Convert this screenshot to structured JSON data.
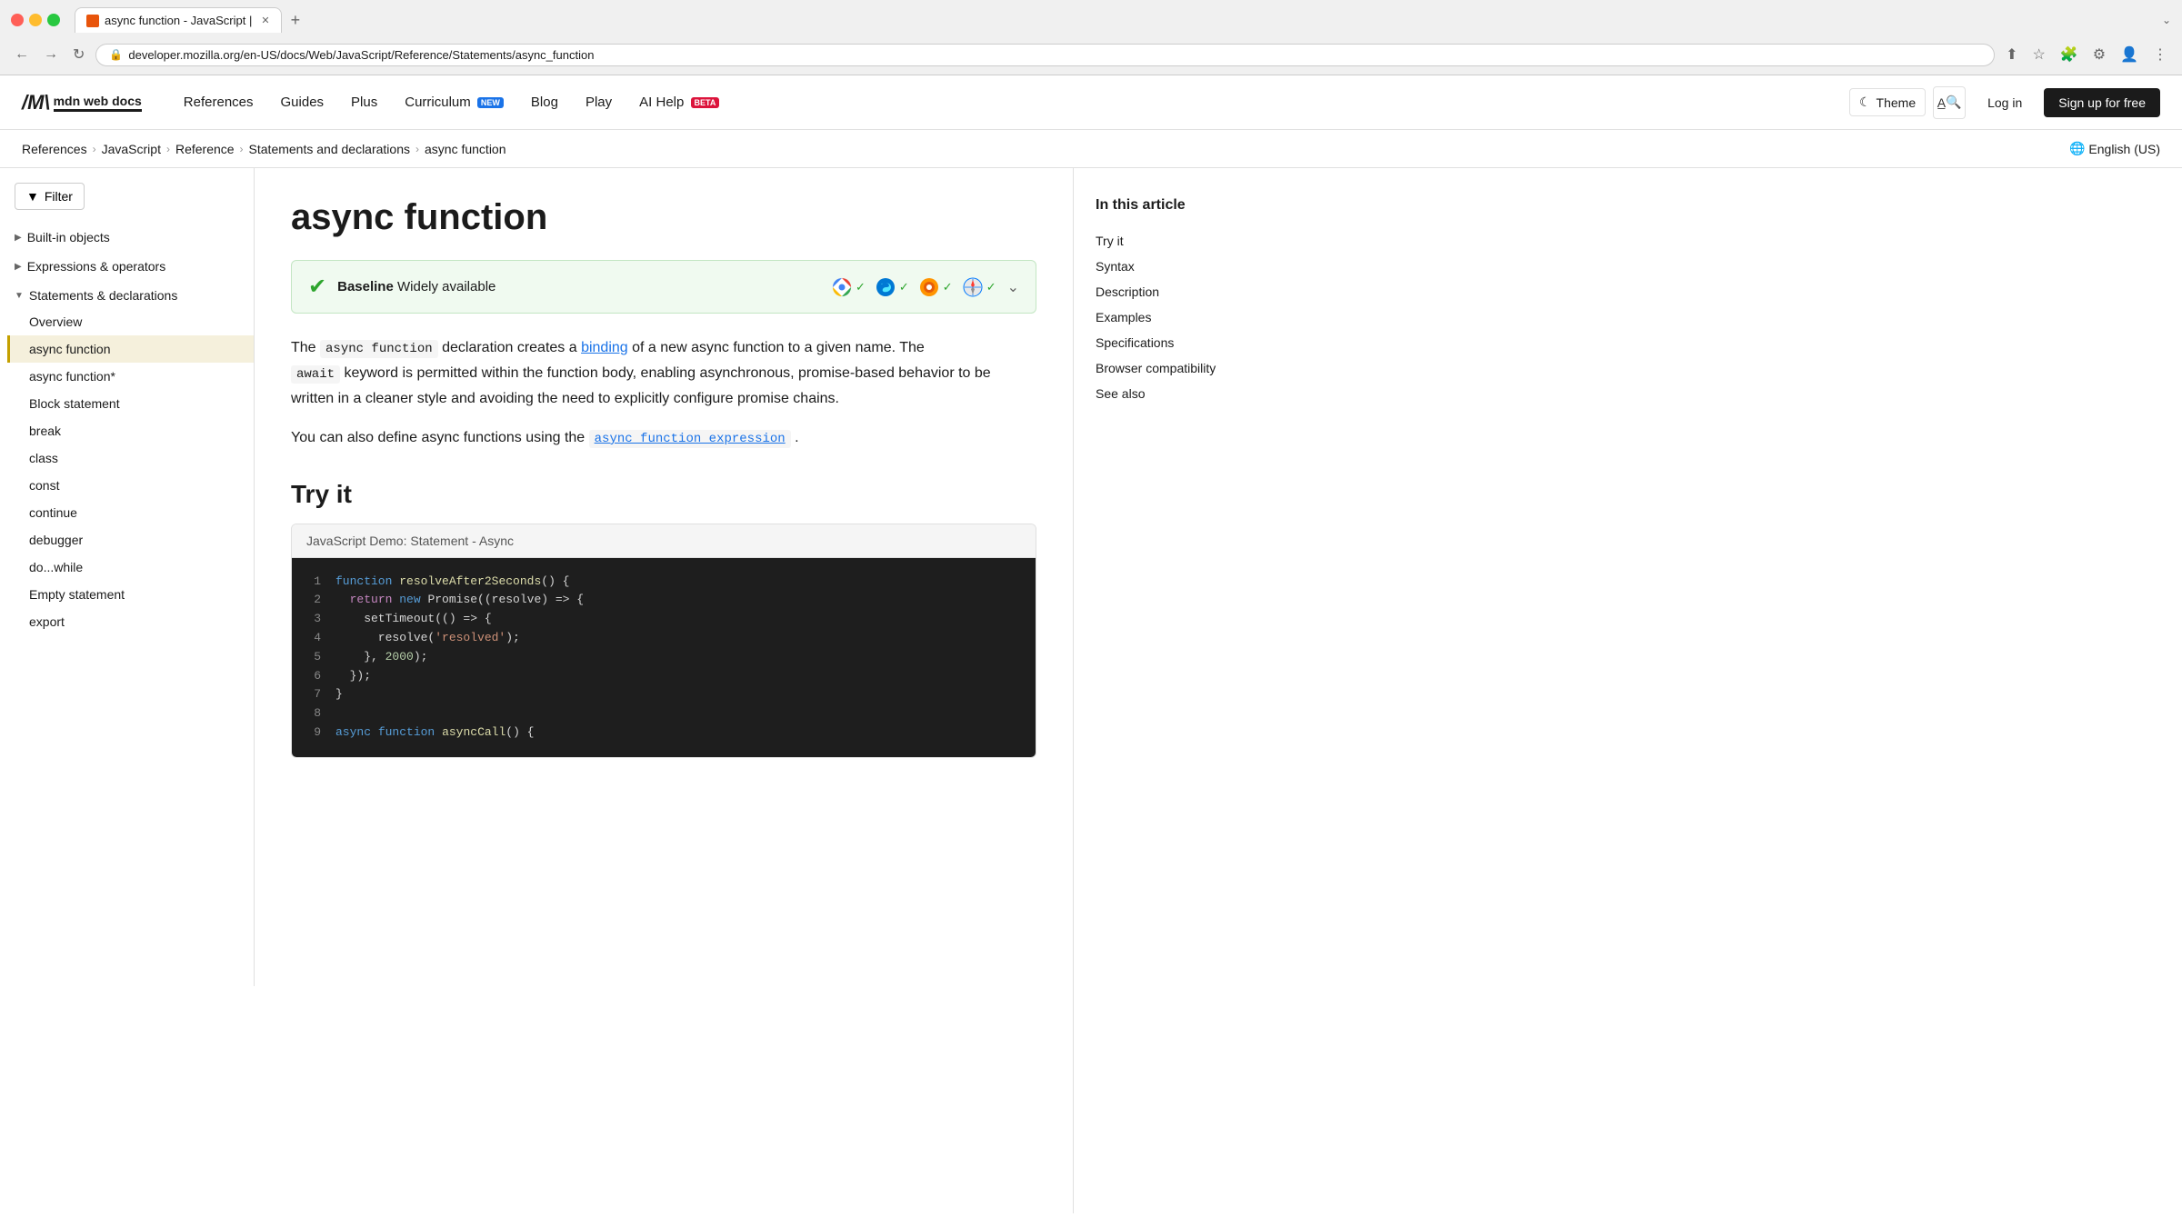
{
  "browser": {
    "tab_title": "async function - JavaScript |",
    "tab_favicon_label": "M",
    "address": "developer.mozilla.org/en-US/docs/Web/JavaScript/Reference/Statements/async_function",
    "new_tab_label": "+",
    "expand_label": "⌄"
  },
  "nav": {
    "back_btn": "←",
    "forward_btn": "→",
    "reload_btn": "↻",
    "logo_m": "/",
    "logo_text": "mdn web docs",
    "links": [
      {
        "label": "References",
        "badge": null
      },
      {
        "label": "Guides",
        "badge": null
      },
      {
        "label": "Plus",
        "badge": null
      },
      {
        "label": "Curriculum",
        "badge": "NEW"
      },
      {
        "label": "Blog",
        "badge": null
      },
      {
        "label": "Play",
        "badge": null
      },
      {
        "label": "AI Help",
        "badge": "BETA"
      }
    ],
    "theme_label": "Theme",
    "theme_icon": "☾",
    "search_icon": "🔍",
    "login_label": "Log in",
    "signup_label": "Sign up for free"
  },
  "breadcrumb": {
    "items": [
      {
        "label": "References",
        "href": "#"
      },
      {
        "label": "JavaScript",
        "href": "#"
      },
      {
        "label": "Reference",
        "href": "#"
      },
      {
        "label": "Statements and declarations",
        "href": "#"
      },
      {
        "label": "async function",
        "href": "#"
      }
    ],
    "lang_icon": "🌐",
    "lang_label": "English (US)"
  },
  "sidebar": {
    "filter_icon": "▼",
    "filter_label": "Filter",
    "sections": [
      {
        "id": "built-in-objects",
        "label": "Built-in objects",
        "expanded": false,
        "chevron": "▶",
        "items": []
      },
      {
        "id": "expressions-operators",
        "label": "Expressions & operators",
        "expanded": false,
        "chevron": "▶",
        "items": []
      },
      {
        "id": "statements-declarations",
        "label": "Statements & declarations",
        "expanded": true,
        "chevron": "▼",
        "items": [
          {
            "label": "Overview",
            "active": false
          },
          {
            "label": "async function",
            "active": true
          },
          {
            "label": "async function*",
            "active": false
          },
          {
            "label": "Block statement",
            "active": false
          },
          {
            "label": "break",
            "active": false
          },
          {
            "label": "class",
            "active": false
          },
          {
            "label": "const",
            "active": false
          },
          {
            "label": "continue",
            "active": false
          },
          {
            "label": "debugger",
            "active": false
          },
          {
            "label": "do...while",
            "active": false
          },
          {
            "label": "Empty statement",
            "active": false
          },
          {
            "label": "export",
            "active": false
          }
        ]
      }
    ]
  },
  "content": {
    "page_title": "async function",
    "baseline": {
      "check_icon": "✔",
      "label_bold": "Baseline",
      "label_text": "Widely available",
      "expand_icon": "⌄",
      "browsers": [
        {
          "name": "chrome",
          "check": "✓"
        },
        {
          "name": "edge",
          "check": "✓"
        },
        {
          "name": "firefox",
          "check": "✓"
        },
        {
          "name": "safari",
          "check": "✓"
        }
      ]
    },
    "intro_p1_before": "The ",
    "intro_code1": "async function",
    "intro_p1_mid": " declaration creates a ",
    "intro_link": "binding",
    "intro_p1_after": " of a new async function to a given name. The",
    "intro_code2": "await",
    "intro_p2": "keyword is permitted within the function body, enabling asynchronous, promise-based behavior to be written in a cleaner style and avoiding the need to explicitly configure promise chains.",
    "intro_p3_before": "You can also define async functions using the ",
    "intro_link2": "async function expression",
    "intro_p3_after": ".",
    "try_it_title": "Try it",
    "demo": {
      "header": "JavaScript Demo: Statement - Async",
      "lines": [
        {
          "num": "1",
          "tokens": [
            {
              "t": "kw-blue",
              "v": "function"
            },
            {
              "t": "fn-yellow",
              "v": " resolveAfter2Seconds"
            },
            {
              "t": "def",
              "v": "() {"
            }
          ]
        },
        {
          "num": "2",
          "tokens": [
            {
              "t": "kw-purple",
              "v": "  return"
            },
            {
              "t": "def",
              "v": " "
            },
            {
              "t": "kw-blue",
              "v": "new"
            },
            {
              "t": "def",
              "v": " Promise((resolve) => {"
            }
          ]
        },
        {
          "num": "3",
          "tokens": [
            {
              "t": "def",
              "v": "    setTimeout(() => {"
            }
          ]
        },
        {
          "num": "4",
          "tokens": [
            {
              "t": "def",
              "v": "      resolve("
            },
            {
              "t": "str-orange",
              "v": "'resolved'"
            },
            {
              "t": "def",
              "v": ");"
            }
          ]
        },
        {
          "num": "5",
          "tokens": [
            {
              "t": "def",
              "v": "    }, "
            },
            {
              "t": "num-green",
              "v": "2000"
            },
            {
              "t": "def",
              "v": ");"
            }
          ]
        },
        {
          "num": "6",
          "tokens": [
            {
              "t": "def",
              "v": "  });"
            }
          ]
        },
        {
          "num": "7",
          "tokens": [
            {
              "t": "def",
              "v": "}"
            }
          ]
        },
        {
          "num": "8",
          "tokens": [
            {
              "t": "def",
              "v": ""
            }
          ]
        },
        {
          "num": "9",
          "tokens": [
            {
              "t": "kw-blue",
              "v": "async"
            },
            {
              "t": "def",
              "v": " "
            },
            {
              "t": "kw-blue",
              "v": "function"
            },
            {
              "t": "fn-yellow",
              "v": " asyncCall"
            },
            {
              "t": "def",
              "v": "() {"
            }
          ]
        }
      ]
    }
  },
  "toc": {
    "title": "In this article",
    "items": [
      {
        "label": "Try it",
        "active": false
      },
      {
        "label": "Syntax",
        "active": false
      },
      {
        "label": "Description",
        "active": false
      },
      {
        "label": "Examples",
        "active": false
      },
      {
        "label": "Specifications",
        "active": false
      },
      {
        "label": "Browser compatibility",
        "active": false
      },
      {
        "label": "See also",
        "active": false
      }
    ]
  }
}
